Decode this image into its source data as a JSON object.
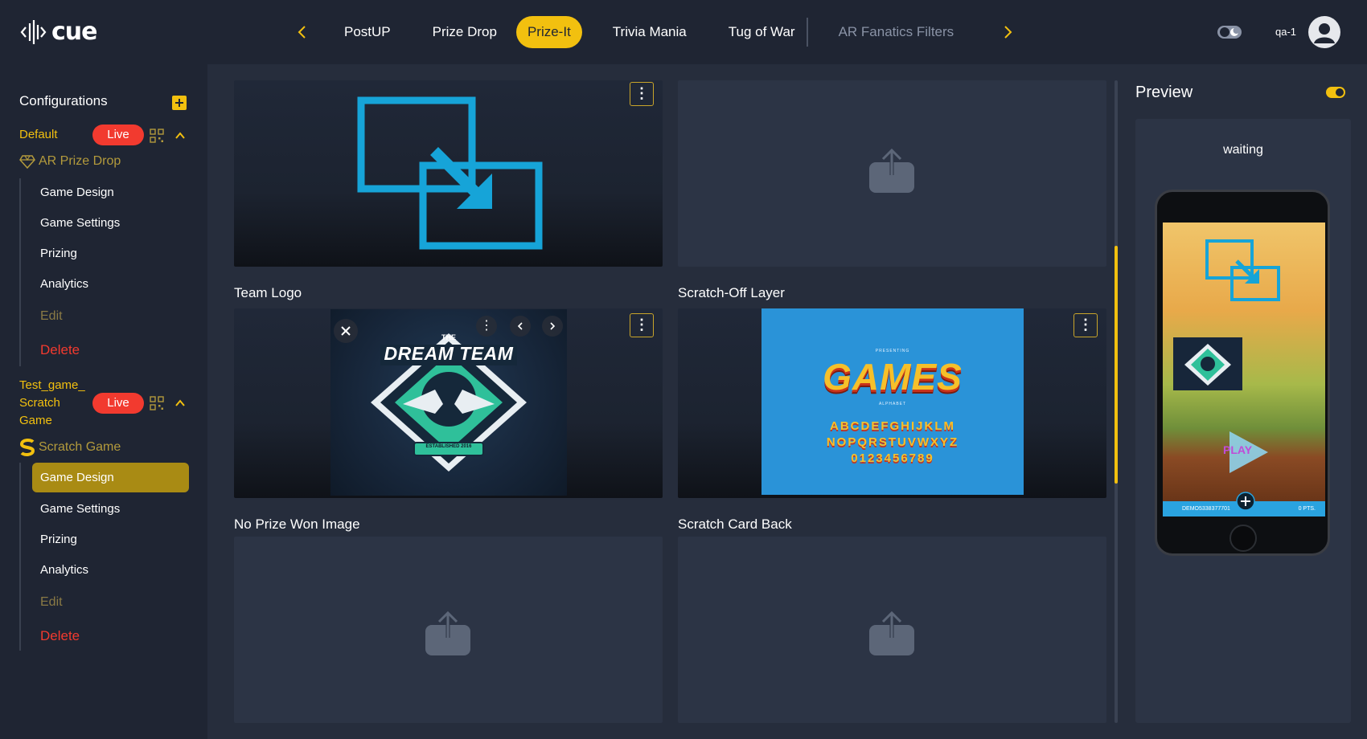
{
  "brand": {
    "name": "cue"
  },
  "nav": {
    "tabs": [
      {
        "label": "PostUP",
        "state": "normal"
      },
      {
        "label": "Prize Drop",
        "state": "normal"
      },
      {
        "label": "Prize-It",
        "state": "active"
      },
      {
        "label": "Trivia Mania",
        "state": "normal"
      },
      {
        "label": "Tug of War",
        "state": "normal"
      },
      {
        "label": "AR Fanatics Filters",
        "state": "muted"
      }
    ],
    "prev_icon": "chevron-left-icon",
    "next_icon": "chevron-right-icon"
  },
  "user": {
    "label": "qa-1"
  },
  "sidebar": {
    "title": "Configurations",
    "configs": [
      {
        "name": "Default",
        "live_label": "Live",
        "game_type": "AR Prize Drop",
        "items": [
          "Game Design",
          "Game Settings",
          "Prizing",
          "Analytics"
        ],
        "edit_label": "Edit",
        "delete_label": "Delete"
      },
      {
        "name_lines": [
          "Test_game_",
          "Scratch",
          "Game"
        ],
        "live_label": "Live",
        "game_type": "Scratch Game",
        "items": [
          "Game Design",
          "Game Settings",
          "Prizing",
          "Analytics"
        ],
        "active_item": "Game Design",
        "edit_label": "Edit",
        "delete_label": "Delete"
      }
    ]
  },
  "main": {
    "cards": {
      "team_logo": {
        "label": "Team Logo",
        "image_text": "DREAM TEAM",
        "image_small_text": "THE",
        "image_banner": "ESTABLISHED 2016"
      },
      "scratch_off": {
        "label": "Scratch-Off Layer",
        "image_top": "PRESENTING",
        "image_title": "GAMES",
        "image_sub": "ALPHABET",
        "image_rows": [
          "ABCDEFGHIJKLM",
          "NOPQRSTUVWXYZ",
          "0123456789"
        ]
      },
      "no_prize": {
        "label": "No Prize Won Image"
      },
      "card_back": {
        "label": "Scratch Card Back"
      }
    }
  },
  "preview": {
    "title": "Preview",
    "status": "waiting",
    "play_label": "PLAY",
    "bar_left": "DEMO5338377701",
    "bar_right": "0 PTS."
  },
  "colors": {
    "accent": "#f2c00f",
    "live": "#f23a2f",
    "background": "#1f2533",
    "panel": "#262d3c",
    "icon_blue": "#16a4d8"
  }
}
